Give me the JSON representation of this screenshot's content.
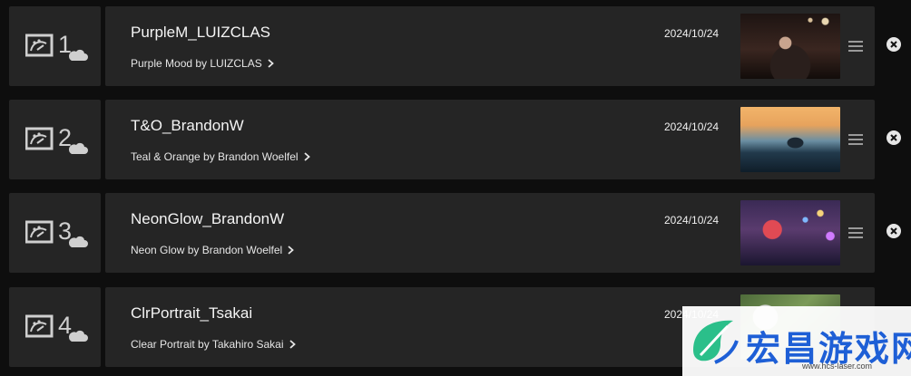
{
  "items": [
    {
      "number": "1",
      "title": "PurpleM_LUIZCLAS",
      "subtitle": "Purple Mood by LUIZCLAS",
      "date": "2024/10/24"
    },
    {
      "number": "2",
      "title": "T&O_BrandonW",
      "subtitle": "Teal & Orange by Brandon Woelfel",
      "date": "2024/10/24"
    },
    {
      "number": "3",
      "title": "NeonGlow_BrandonW",
      "subtitle": "Neon Glow by Brandon Woelfel",
      "date": "2024/10/24"
    },
    {
      "number": "4",
      "title": "ClrPortrait_Tsakai",
      "subtitle": "Clear Portrait by Takahiro Sakai",
      "date": "2024/10/24"
    }
  ],
  "watermark": {
    "text": "宏昌游戏网",
    "url": "www.hcs-laser.com"
  },
  "colors": {
    "row_bg": "#252525",
    "page_bg": "#0e0e0e",
    "watermark_blue": "#1e5fd6",
    "watermark_green": "#2bbf8a"
  },
  "icons": {
    "slot": "photo-cloud-icon",
    "link": "chevron-right-icon",
    "drag": "drag-handle-icon",
    "remove": "close-circle-icon"
  }
}
